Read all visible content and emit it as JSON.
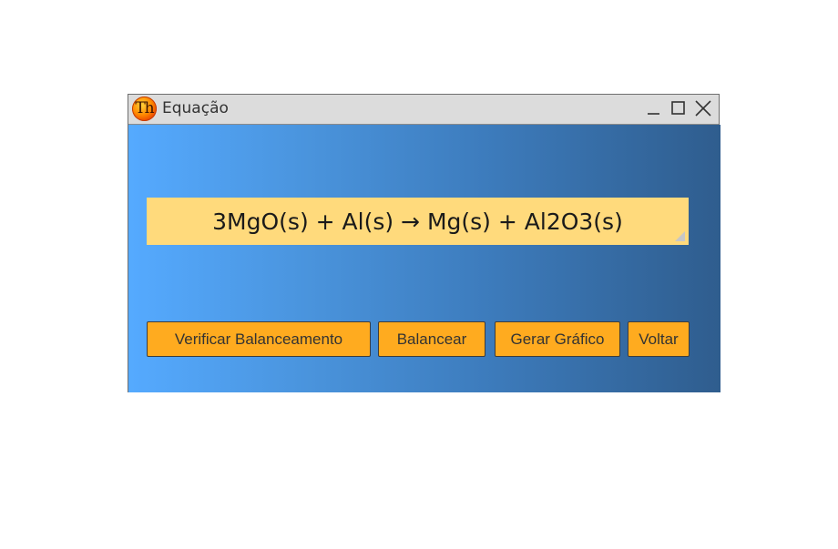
{
  "window": {
    "title": "Equação",
    "app_icon_text": "Th",
    "controls": {
      "minimize": "minimize-icon",
      "maximize": "maximize-icon",
      "close": "close-icon"
    }
  },
  "equation": {
    "text": "3MgO(s) + Al(s) → Mg(s) + Al2O3(s)"
  },
  "buttons": {
    "verify": "Verificar Balanceamento",
    "balance": "Balancear",
    "graph": "Gerar Gráfico",
    "back": "Voltar"
  },
  "colors": {
    "gradient_start": "#55aaff",
    "gradient_end": "#2f5d8e",
    "equation_bg": "#ffda7c",
    "button_bg": "#ffab1f",
    "titlebar_bg": "#dcdcdc"
  }
}
